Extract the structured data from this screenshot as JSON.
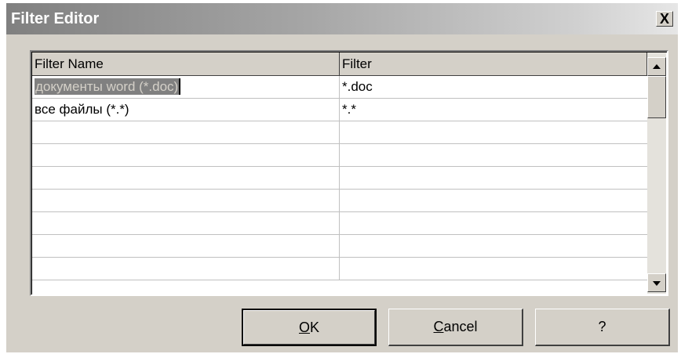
{
  "window": {
    "title": "Filter Editor",
    "close_label": "X"
  },
  "grid": {
    "columns": [
      "Filter Name",
      "Filter"
    ],
    "rows": [
      {
        "name": "документы word (*.doc)",
        "filter": "*.doc",
        "selected": true
      },
      {
        "name": "все файлы (*.*)",
        "filter": "*.*",
        "selected": false
      },
      {
        "name": "",
        "filter": "",
        "selected": false
      },
      {
        "name": "",
        "filter": "",
        "selected": false
      },
      {
        "name": "",
        "filter": "",
        "selected": false
      },
      {
        "name": "",
        "filter": "",
        "selected": false
      },
      {
        "name": "",
        "filter": "",
        "selected": false
      },
      {
        "name": "",
        "filter": "",
        "selected": false
      },
      {
        "name": "",
        "filter": "",
        "selected": false
      }
    ]
  },
  "buttons": {
    "ok": {
      "mnemonic": "O",
      "rest": "K"
    },
    "cancel": {
      "mnemonic": "C",
      "rest": "ancel"
    },
    "help": "?"
  },
  "colors": {
    "face": "#d4d0c8",
    "title_gradient_start": "#808080",
    "selection": "#808080"
  },
  "icons": {
    "close": "close-icon",
    "scroll_up": "arrow-up-icon",
    "scroll_down": "arrow-down-icon"
  }
}
